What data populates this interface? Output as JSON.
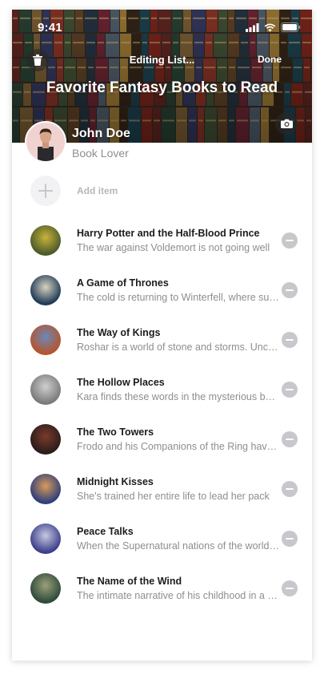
{
  "status_bar": {
    "time": "9:41"
  },
  "header": {
    "edit_title": "Editing List...",
    "done_label": "Done",
    "list_title": "Favorite Fantasy Books to Read"
  },
  "user": {
    "name": "John Doe",
    "bio": "Book Lover"
  },
  "add_item": {
    "label": "Add item"
  },
  "books": [
    {
      "title": "Harry Potter and the Half-Blood Prince",
      "description": "The war against Voldemort is not going well",
      "cover_colors": [
        "#4b5a2a",
        "#c9b33a"
      ]
    },
    {
      "title": "A Game of Thrones",
      "description": "The cold is returning to Winterfell, where summer is ending",
      "cover_colors": [
        "#1f3a55",
        "#d8d2c0"
      ]
    },
    {
      "title": "The Way of Kings",
      "description": "Roshar is a world of stone and storms. Uncanny tempests",
      "cover_colors": [
        "#b5552e",
        "#6b88b8"
      ]
    },
    {
      "title": "The Hollow Places",
      "description": "Kara finds these words in the mysterious bunker",
      "cover_colors": [
        "#7a7a7a",
        "#cfcfcf"
      ]
    },
    {
      "title": "The Two Towers",
      "description": "Frodo and his Companions of the Ring have been beset",
      "cover_colors": [
        "#2b1c1c",
        "#7a3a2a"
      ]
    },
    {
      "title": "Midnight Kisses",
      "description": "She's trained her entire life to lead her pack",
      "cover_colors": [
        "#2e3f7a",
        "#d99a5a"
      ]
    },
    {
      "title": "Peace Talks",
      "description": "When the Supernatural nations of the world meet",
      "cover_colors": [
        "#3b3f8a",
        "#c8c8e0"
      ]
    },
    {
      "title": "The Name of the Wind",
      "description": "The intimate narrative of his childhood in a troupe",
      "cover_colors": [
        "#2f4a3a",
        "#9aa07a"
      ]
    }
  ],
  "colors": {
    "accent_white": "#ffffff",
    "secondary_text": "#8e8e93",
    "remove_gray": "#c7c7cc"
  }
}
